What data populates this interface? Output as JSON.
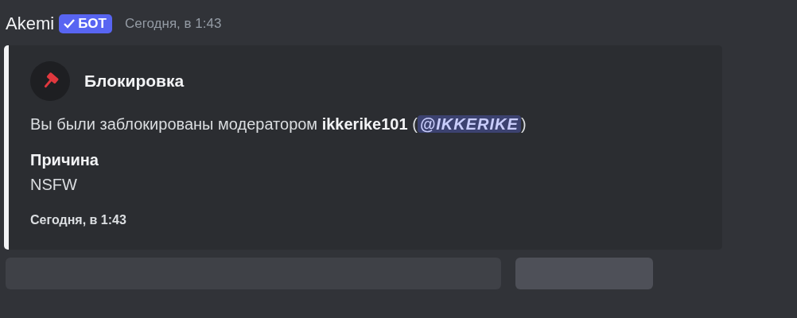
{
  "message": {
    "author": "Akemi",
    "badge": {
      "label": "БОТ",
      "verified": true
    },
    "timestamp": "Сегодня, в 1:43"
  },
  "embed": {
    "title": "Блокировка",
    "description": "Вы были заблокированы модератором **ikkerike101** (",
    "mention": "@IKKERIKE",
    "description_end": ")",
    "fields": [
      {
        "name": "Причина",
        "value": "NSFW"
      }
    ],
    "footer": "Сегодня, в 1:43"
  },
  "buttons": [
    {
      "kind": "wide"
    },
    {
      "kind": "narrow"
    }
  ]
}
